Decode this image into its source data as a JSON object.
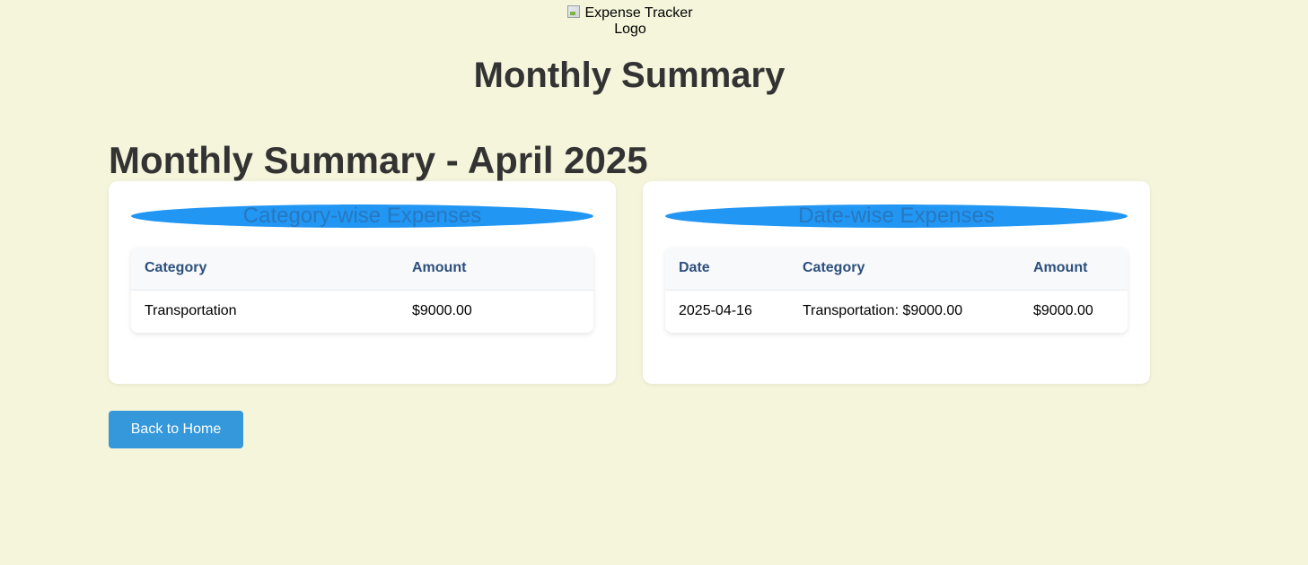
{
  "header": {
    "logo_alt": "Expense Tracker Logo",
    "title": "Monthly Summary"
  },
  "summary": {
    "heading": "Monthly Summary - April 2025"
  },
  "category_card": {
    "heading": "Category-wise Expenses",
    "columns": [
      "Category",
      "Amount"
    ],
    "rows": [
      {
        "category": "Transportation",
        "amount": "$9000.00"
      }
    ]
  },
  "date_card": {
    "heading": "Date-wise Expenses",
    "columns": [
      "Date",
      "Category",
      "Amount"
    ],
    "rows": [
      {
        "date": "2025-04-16",
        "category": "Transportation: $9000.00",
        "amount": "$9000.00"
      }
    ]
  },
  "actions": {
    "back_label": "Back to Home"
  },
  "colors": {
    "background": "#f5f5dc",
    "card_banner": "#2196f3",
    "button": "#3498db",
    "table_header_text": "#2c4f7c"
  }
}
